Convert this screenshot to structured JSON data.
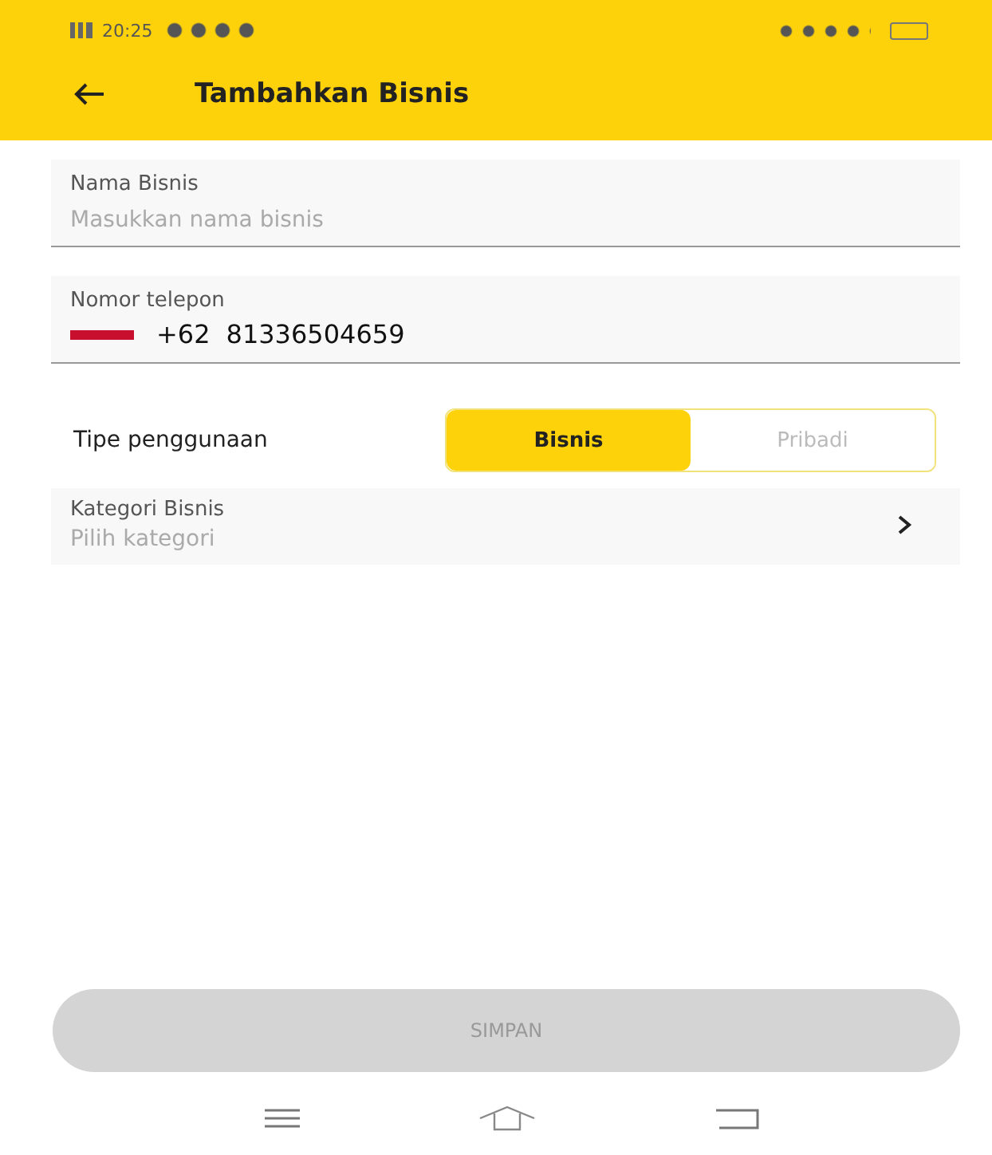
{
  "status_bar": {
    "time": "20:25"
  },
  "header": {
    "title": "Tambahkan Bisnis"
  },
  "fields": [
    {
      "label": "Nama Bisnis",
      "placeholder": "Masukkan nama bisnis"
    },
    {
      "label": "Nomor telepon",
      "prefix": "+62",
      "value": "81336504659"
    }
  ],
  "usage_type": {
    "label": "Tipe penggunaan",
    "options": [
      {
        "label": "Bisnis",
        "selected": true
      },
      {
        "label": "Pribadi",
        "selected": false
      }
    ]
  },
  "category": {
    "label": "Kategori Bisnis",
    "placeholder": "Pilih kategori"
  },
  "save_button": {
    "label": "SIMPAN",
    "disabled": true
  }
}
